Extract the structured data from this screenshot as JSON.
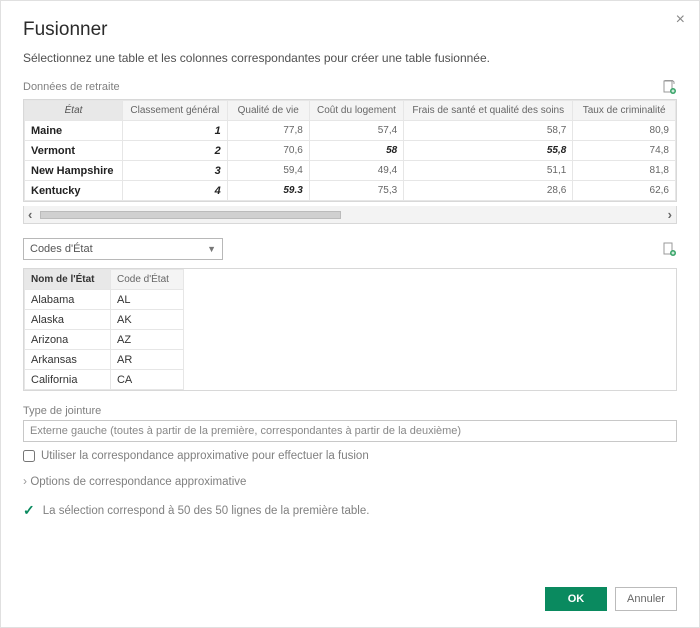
{
  "dialog": {
    "title": "Fusionner",
    "subtitle": "Sélectionnez une table et les colonnes correspondantes pour créer une table fusionnée.",
    "close_label": "×"
  },
  "table1": {
    "label": "Données de retraite",
    "headers": [
      "État",
      "Classement général",
      "Qualité de vie",
      "Coût du logement",
      "Frais de santé et qualité des soins",
      "Taux de criminalité"
    ],
    "rows": [
      {
        "state": "Maine",
        "rank": "1",
        "qol": "77,8",
        "housing": "57,4",
        "health": "58,7",
        "crime": "80,9"
      },
      {
        "state": "Vermont",
        "rank": "2",
        "qol": "70,6",
        "housing": "58",
        "health": "55,8",
        "crime": "74,8",
        "housing_bold": true,
        "health_bold": true
      },
      {
        "state": "New Hampshire",
        "rank": "3",
        "qol": "59,4",
        "housing": "49,4",
        "health": "51,1",
        "crime": "81,8"
      },
      {
        "state": "Kentucky",
        "rank": "4",
        "qol": "59.3",
        "housing": "75,3",
        "health": "28,6",
        "crime": "62,6",
        "qol_bold": true
      }
    ]
  },
  "dropdown": {
    "selected": "Codes d'État"
  },
  "table2": {
    "headers": [
      "Nom de l'État",
      "Code d'État"
    ],
    "rows": [
      {
        "name": "Alabama",
        "code": "AL"
      },
      {
        "name": "Alaska",
        "code": "AK"
      },
      {
        "name": "Arizona",
        "code": "AZ"
      },
      {
        "name": "Arkansas",
        "code": "AR"
      },
      {
        "name": "California",
        "code": "CA"
      }
    ]
  },
  "join": {
    "label": "Type de jointure",
    "value": "Externe gauche (toutes à partir de la première, correspondantes à partir de la deuxième)"
  },
  "fuzzy": {
    "checkbox_label": "Utiliser la correspondance approximative pour effectuer la fusion",
    "options_label": "Options de correspondance approximative"
  },
  "status": {
    "text": "La sélection correspond à 50 des 50 lignes de la première table."
  },
  "buttons": {
    "ok": "OK",
    "cancel": "Annuler"
  }
}
